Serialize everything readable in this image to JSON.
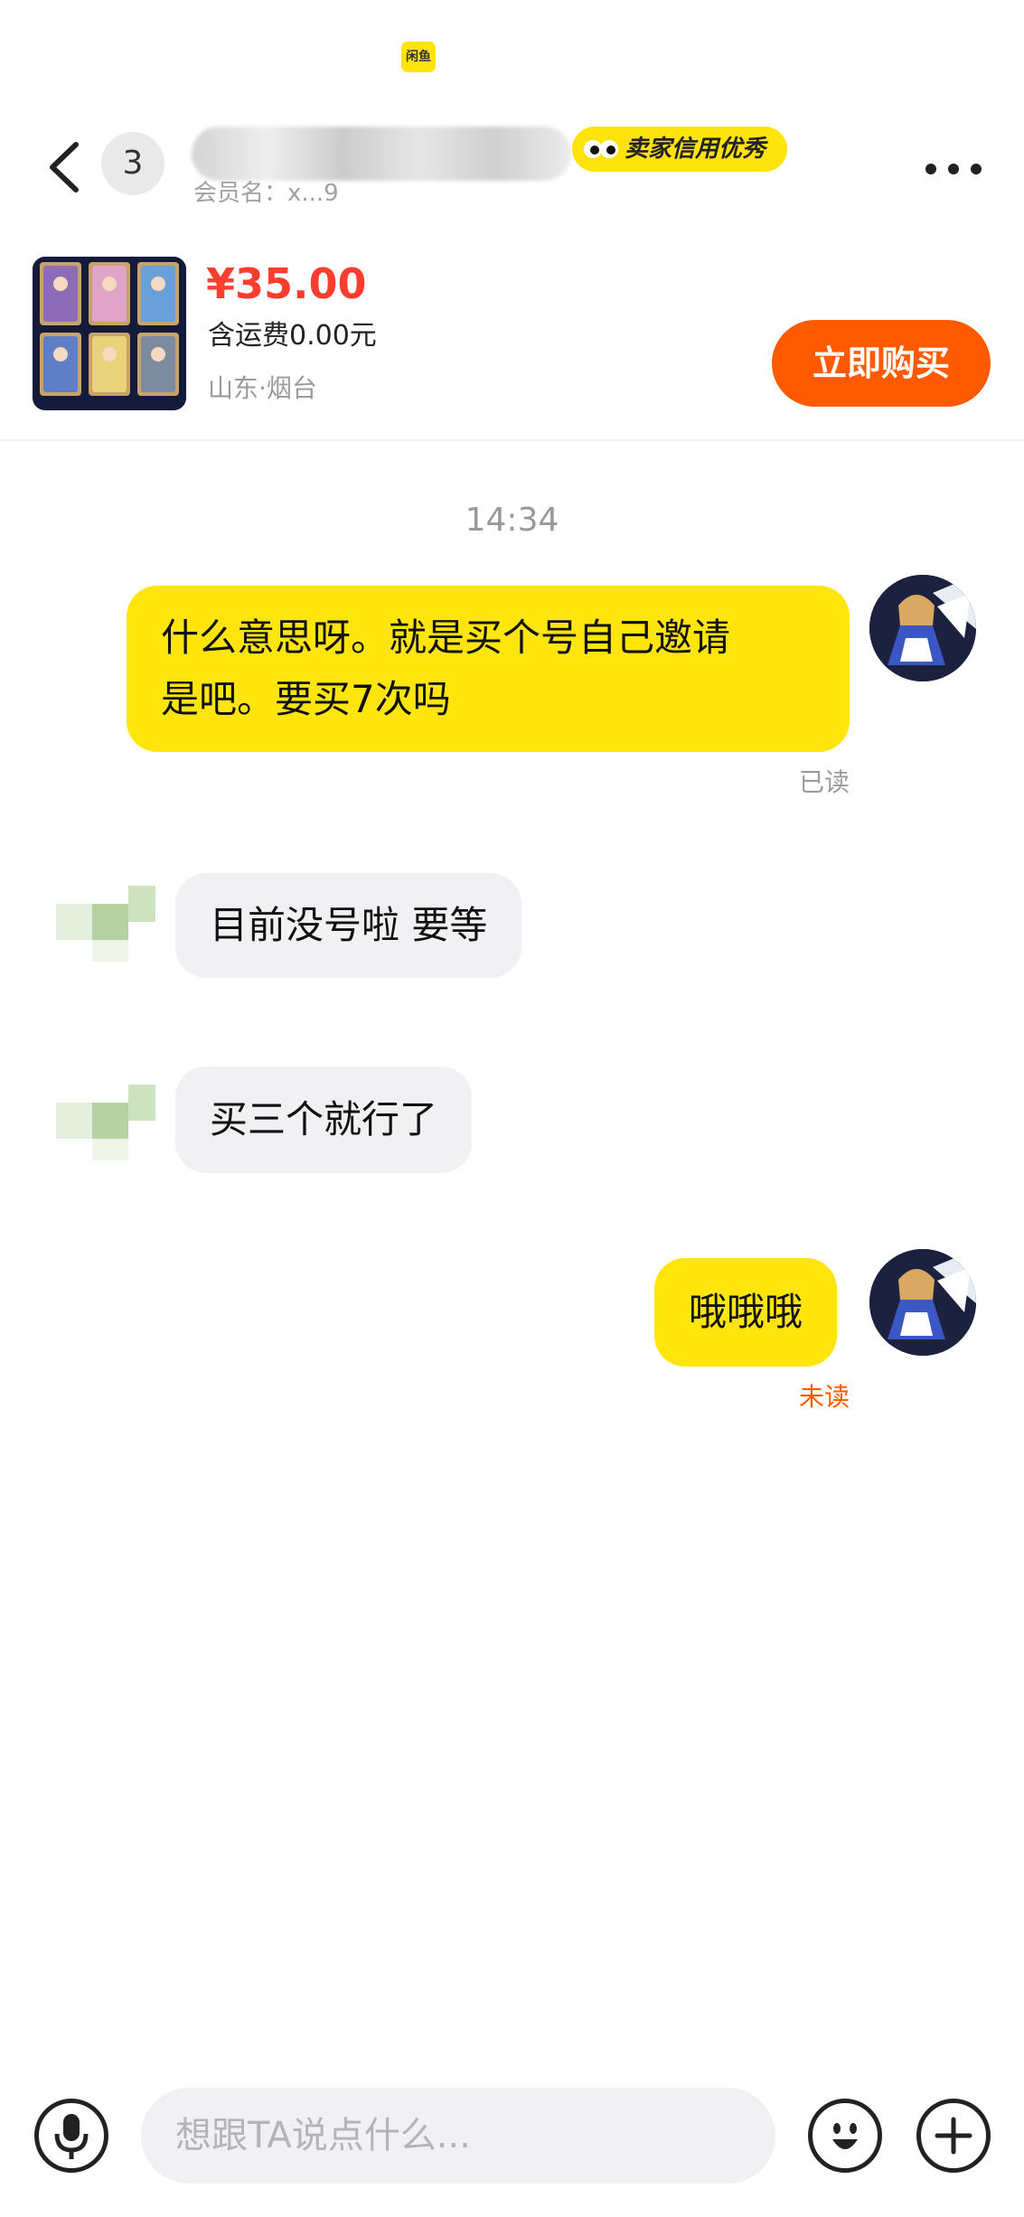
{
  "top_logo": "闲鱼",
  "header": {
    "peer_avatar_text": "3",
    "member_label": "会员名：x...9",
    "credit_badge": "卖家信用优秀"
  },
  "product": {
    "price": "¥35.00",
    "shipping": "含运费0.00元",
    "location": "山东·烟台",
    "buy_label": "立即购买"
  },
  "chat": {
    "timestamp": "14:34",
    "messages": [
      {
        "from": "me",
        "text_line1": "什么意思呀。就是买个号自己邀请",
        "text_line2": "是吧。要买7次吗",
        "status": "已读"
      },
      {
        "from": "peer",
        "text": "目前没号啦  要等"
      },
      {
        "from": "peer",
        "text": "买三个就行了"
      },
      {
        "from": "me",
        "text": "哦哦哦",
        "status": "未读"
      }
    ]
  },
  "input": {
    "placeholder": "想跟TA说点什么..."
  },
  "colors": {
    "brand_yellow": "#ffe50b",
    "buy_orange": "#ff5a00",
    "price_red": "#ff3d2e",
    "unread_orange": "#ff5a00",
    "read_gray": "#9a9a9a"
  },
  "icons": [
    "back-icon",
    "more-icon",
    "microphone-icon",
    "emoji-icon",
    "plus-icon"
  ]
}
